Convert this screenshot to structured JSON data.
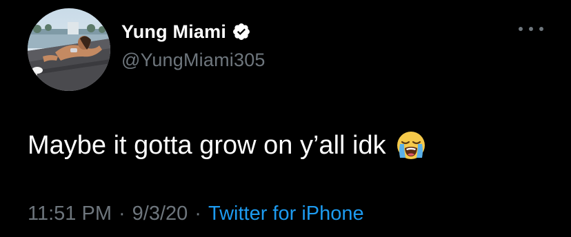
{
  "tweet": {
    "author": {
      "display_name": "Yung Miami",
      "handle": "@YungMiami305",
      "verified": true,
      "avatar_icon": "profile-photo"
    },
    "text": "Maybe it gotta grow on y’all idk",
    "emoji": "loudly-crying-face",
    "time": "11:51 PM",
    "separator": "·",
    "date": "9/3/20",
    "source": "Twitter for iPhone",
    "more_icon": "more-horizontal-icon"
  },
  "colors": {
    "background": "#000000",
    "primary_text": "#ffffff",
    "secondary_text": "#6e767d",
    "link": "#1d9bf0",
    "verified_badge": "#ffffff"
  }
}
